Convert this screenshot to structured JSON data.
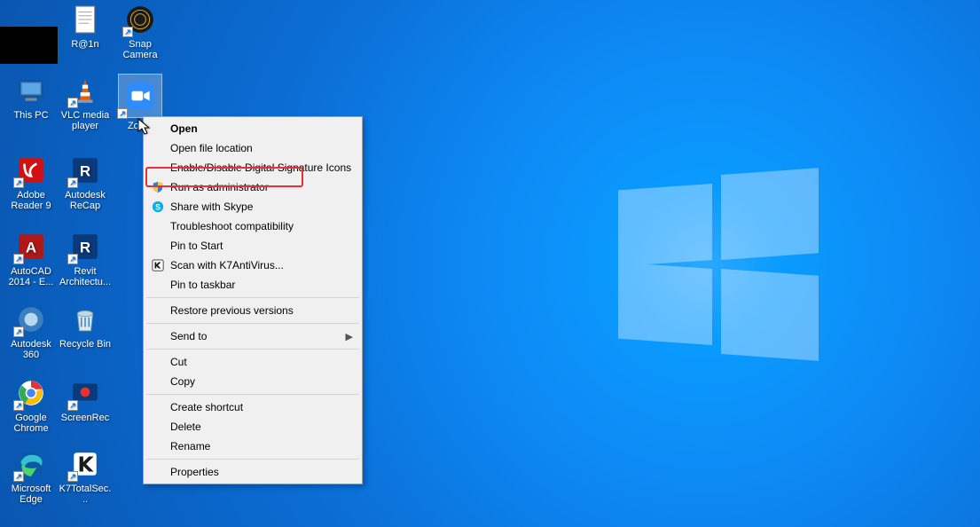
{
  "desktop_icons": {
    "r1c2_label": "R@1n",
    "r1c3_label": "Snap Camera",
    "r2c1_label": "This PC",
    "r2c2_label": "VLC media player",
    "r2c3_label": "Zoom",
    "r3c1_label": "Adobe Reader 9",
    "r3c2_label": "Autodesk ReCap",
    "r4c1_label": "AutoCAD 2014 - E...",
    "r4c2_label": "Revit Architectu...",
    "r5c1_label": "Autodesk 360",
    "r5c2_label": "Recycle Bin",
    "r6c1_label": "Google Chrome",
    "r6c2_label": "ScreenRec",
    "r7c1_label": "Microsoft Edge",
    "r7c2_label": "K7TotalSec..."
  },
  "context_menu": {
    "open": "Open",
    "open_file_location": "Open file location",
    "enable_disable_sig": "Enable/Disable Digital Signature Icons",
    "run_as_admin": "Run as administrator",
    "share_skype": "Share with Skype",
    "troubleshoot": "Troubleshoot compatibility",
    "pin_start": "Pin to Start",
    "scan_k7": "Scan with K7AntiVirus...",
    "pin_taskbar": "Pin to taskbar",
    "restore_prev": "Restore previous versions",
    "send_to": "Send to",
    "cut": "Cut",
    "copy": "Copy",
    "create_shortcut": "Create shortcut",
    "delete": "Delete",
    "rename": "Rename",
    "properties": "Properties"
  },
  "highlight": {
    "target": "run_as_admin"
  }
}
